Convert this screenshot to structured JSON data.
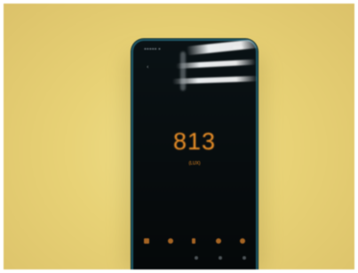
{
  "photo": {
    "background_color": "#e8d276",
    "phone_body_color": "#050809",
    "phone_edge_color": "#1e5766",
    "accent_color": "#f09228"
  },
  "lux_meter_app": {
    "reading": "813",
    "unit": "(LUX)",
    "toolbar_icons": [
      "stop-icon",
      "settings-icon",
      "pause-icon",
      "refresh-icon",
      "chart-icon"
    ],
    "bottom_icons": [
      "dot-icon",
      "dot-icon",
      "pin-icon"
    ]
  }
}
